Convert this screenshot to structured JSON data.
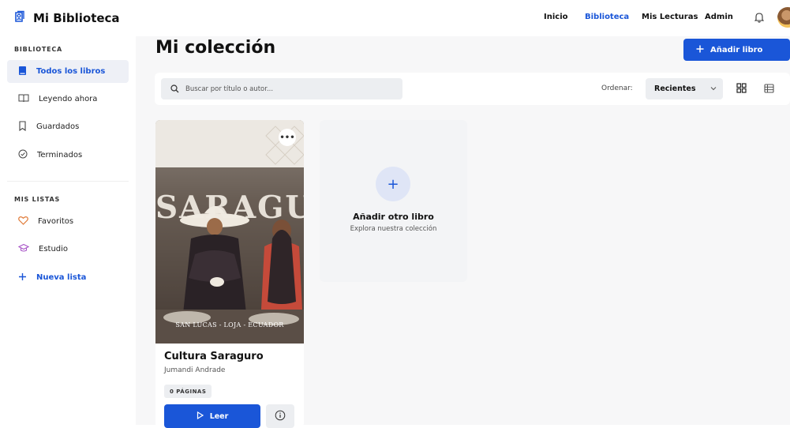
{
  "app": {
    "title": "Mi Biblioteca",
    "brand_icon": "book-user-icon"
  },
  "nav": [
    {
      "label": "Inicio",
      "active": false
    },
    {
      "label": "Biblioteca",
      "active": true
    },
    {
      "label": "Mis Lecturas",
      "active": false
    },
    {
      "label": "Admin",
      "active": false
    }
  ],
  "colors": {
    "accent": "#1a56d8",
    "active_bg": "#eef0f6",
    "page_bg": "#f7f7f8"
  },
  "sidebar": {
    "section1": "BIBLIOTECA",
    "items": [
      {
        "label": "Todos los libros",
        "icon": "book-icon",
        "active": true
      },
      {
        "label": "Leyendo ahora",
        "icon": "open-book-icon",
        "active": false
      },
      {
        "label": "Guardados",
        "icon": "bookmark-icon",
        "active": false
      },
      {
        "label": "Terminados",
        "icon": "check-circle-icon",
        "active": false
      }
    ],
    "section2": "MIS LISTAS",
    "lists": [
      {
        "label": "Favoritos",
        "icon": "heart-icon"
      },
      {
        "label": "Estudio",
        "icon": "graduation-cap-icon"
      }
    ],
    "new_list": "Nueva lista"
  },
  "main": {
    "title": "Mi colección",
    "add_button": "Añadir libro",
    "search": {
      "placeholder": "Buscar por título o autor..."
    },
    "sort": {
      "label": "Ordenar:",
      "value": "Recientes"
    },
    "view_modes": [
      "grid-view-icon",
      "list-view-icon"
    ]
  },
  "book": {
    "title": "Cultura Saraguro",
    "author": "Jumandi Andrade",
    "pages": "0 PÁGINAS",
    "read_label": "Leer",
    "cover_title": "SARAGURO",
    "cover_footer": "SAN LUCAS - LOJA - ECUADOR"
  },
  "add_card": {
    "title": "Añadir otro libro",
    "subtitle": "Explora nuestra colección"
  }
}
